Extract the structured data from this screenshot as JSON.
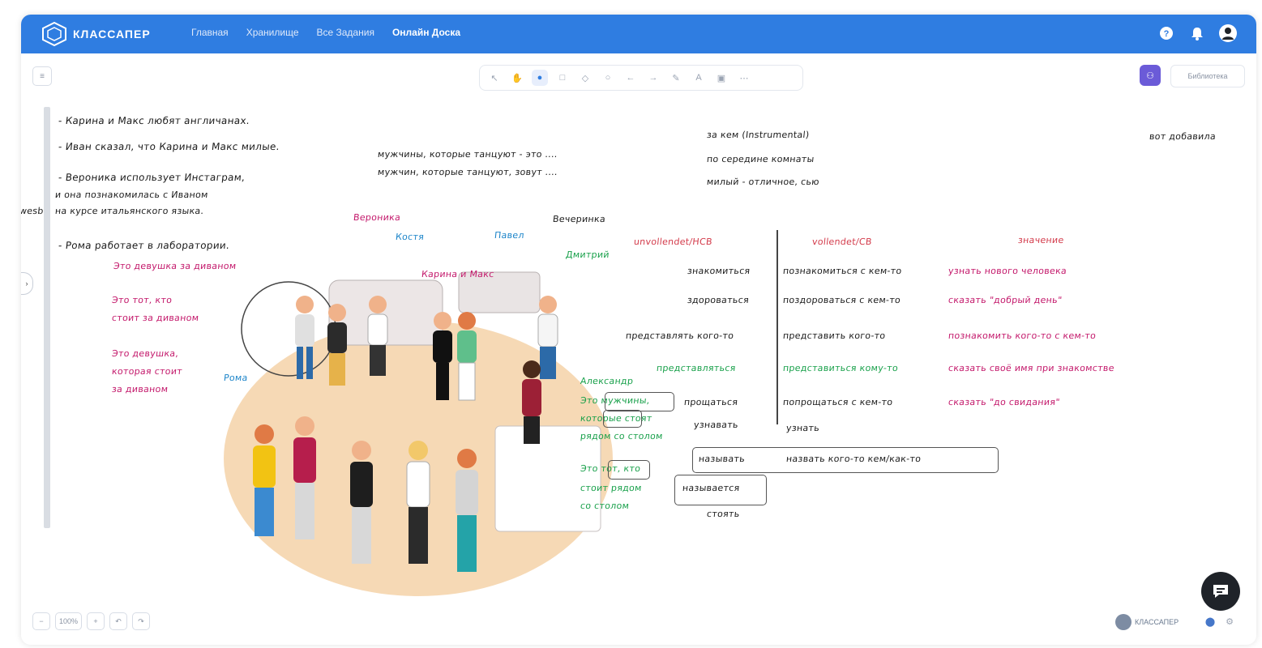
{
  "app": {
    "logo_text": "КЛАССАПЕР",
    "nav": [
      "Главная",
      "Хранилище",
      "Все Задания",
      "Онлайн Доска"
    ],
    "active_nav_index": 3,
    "brand_color": "#2f7de1",
    "top_icons": [
      "help-icon",
      "bell-icon",
      "user-avatar"
    ]
  },
  "board": {
    "toolbar_tools": [
      "cursor-icon",
      "hand-icon",
      "pen-icon",
      "shape-icon",
      "eraser-icon",
      "lasso-icon",
      "undo-arrow-icon",
      "redo-arrow-icon",
      "pencil-icon",
      "text-icon",
      "image-icon",
      "more-icon"
    ],
    "library_label": "Библиотека",
    "zoom_level": "100%",
    "brand_footer": "КЛАССАПЕР",
    "handwriting": {
      "left_notes": [
        "- Карина и Макс любят англичанах.",
        "- Иван сказал, что Карина и Макс милые.",
        "- Вероника использует Инстаграм,",
        "и она познакомилась с Иваном",
        "на курсе итальянского языка.",
        "- Рома работает в лаборатории."
      ],
      "vesb": "wesb",
      "pink_notes": [
        "Это девушка за диваном",
        "Это тот, кто",
        "стоит за диваном",
        "Это девушка,",
        "которая стоит",
        "за диваном"
      ],
      "middle_notes": [
        "мужчины, которые танцуют - это ....",
        "мужчин, которые танцуют, зовут ...."
      ],
      "top_right_notes": [
        "за кем (Instrumental)",
        "по середине комнаты",
        "милый - отличное, сью"
      ],
      "far_right": "вот добавила",
      "party_label": "Вечеринка",
      "names": [
        "Вероника",
        "Костя",
        "Павел",
        "Дмитрий",
        "Карина и Макс",
        "Рома",
        "Александр"
      ],
      "green_notes": [
        "Это мужчины,",
        "которые стоят",
        "рядом со столом",
        "Это тот, кто",
        "стоит рядом",
        "со столом"
      ],
      "table_headers": [
        "unvollendet/НСВ",
        "vollendet/СВ",
        "значение"
      ],
      "table_left": [
        "знакомиться",
        "здороваться",
        "представлять кого-то",
        "представляться",
        "прощаться",
        "узнавать",
        "называть",
        "называется",
        "стоять"
      ],
      "table_mid": [
        "познакомиться с кем-то",
        "поздороваться с кем-то",
        "представить кого-то",
        "представиться кому-то",
        "попрощаться с кем-то",
        "узнать",
        "назвать   кого-то кем/как-то"
      ],
      "table_right": [
        "узнать нового человека",
        "сказать \"добрый день\"",
        "познакомить кого-то с кем-то",
        "сказать своё имя при знакомстве",
        "сказать \"до свидания\""
      ]
    }
  }
}
